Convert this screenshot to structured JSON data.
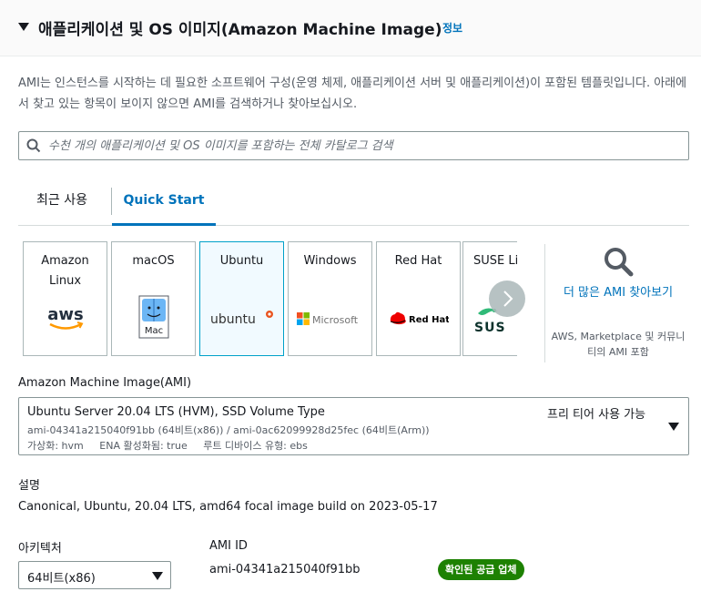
{
  "section": {
    "title": "애플리케이션 및 OS 이미지(Amazon Machine Image)",
    "info_link": "정보",
    "description": "AMI는 인스턴스를 시작하는 데 필요한 소프트웨어 구성(운영 체제, 애플리케이션 서버 및 애플리케이션)이 포함된 템플릿입니다. 아래에서 찾고 있는 항목이 보이지 않으면 AMI를 검색하거나 찾아보십시오."
  },
  "search": {
    "placeholder": "수천 개의 애플리케이션 및 OS 이미지를 포함하는 전체 카탈로그 검색",
    "value": ""
  },
  "tabs": [
    {
      "label": "최근 사용",
      "active": false
    },
    {
      "label": "Quick Start",
      "active": true
    }
  ],
  "os_cards": [
    {
      "label": "Amazon Linux",
      "logo_text": "aws",
      "selected": false
    },
    {
      "label": "macOS",
      "logo_text": "Mac",
      "selected": false
    },
    {
      "label": "Ubuntu",
      "logo_text": "ubuntu",
      "selected": true
    },
    {
      "label": "Windows",
      "logo_text": "Microsoft",
      "selected": false
    },
    {
      "label": "Red Hat",
      "logo_text": "Red Hat",
      "selected": false
    },
    {
      "label": "SUSE Li",
      "logo_text": "SUS",
      "selected": false
    }
  ],
  "more": {
    "link": "더 많은 AMI 찾아보기",
    "subtext": "AWS, Marketplace 및 커뮤니티의 AMI 포함"
  },
  "ami": {
    "label": "Amazon Machine Image(AMI)",
    "name": "Ubuntu Server 20.04 LTS (HVM), SSD Volume Type",
    "free_tier": "프리 티어 사용 가능",
    "ids": "ami-04341a215040f91bb (64비트(x86)) / ami-0ac62099928d25fec (64비트(Arm))",
    "virtualization": "가상화: hvm",
    "ena": "ENA 활성화됨: true",
    "root_device": "루트 디바이스 유형: ebs"
  },
  "description_field": {
    "label": "설명",
    "value": "Canonical, Ubuntu, 20.04 LTS, amd64 focal image build on 2023-05-17"
  },
  "architecture": {
    "label": "아키텍처",
    "value": "64비트(x86)"
  },
  "ami_id": {
    "label": "AMI ID",
    "value": "ami-04341a215040f91bb",
    "badge": "확인된 공급 업체"
  },
  "colors": {
    "link": "#0073bb",
    "badge": "#1d8102",
    "selected_card_bg": "#f1faff",
    "ubuntu_orange": "#e95420",
    "redhat_red": "#ee0000",
    "suse_green": "#30ba78"
  }
}
